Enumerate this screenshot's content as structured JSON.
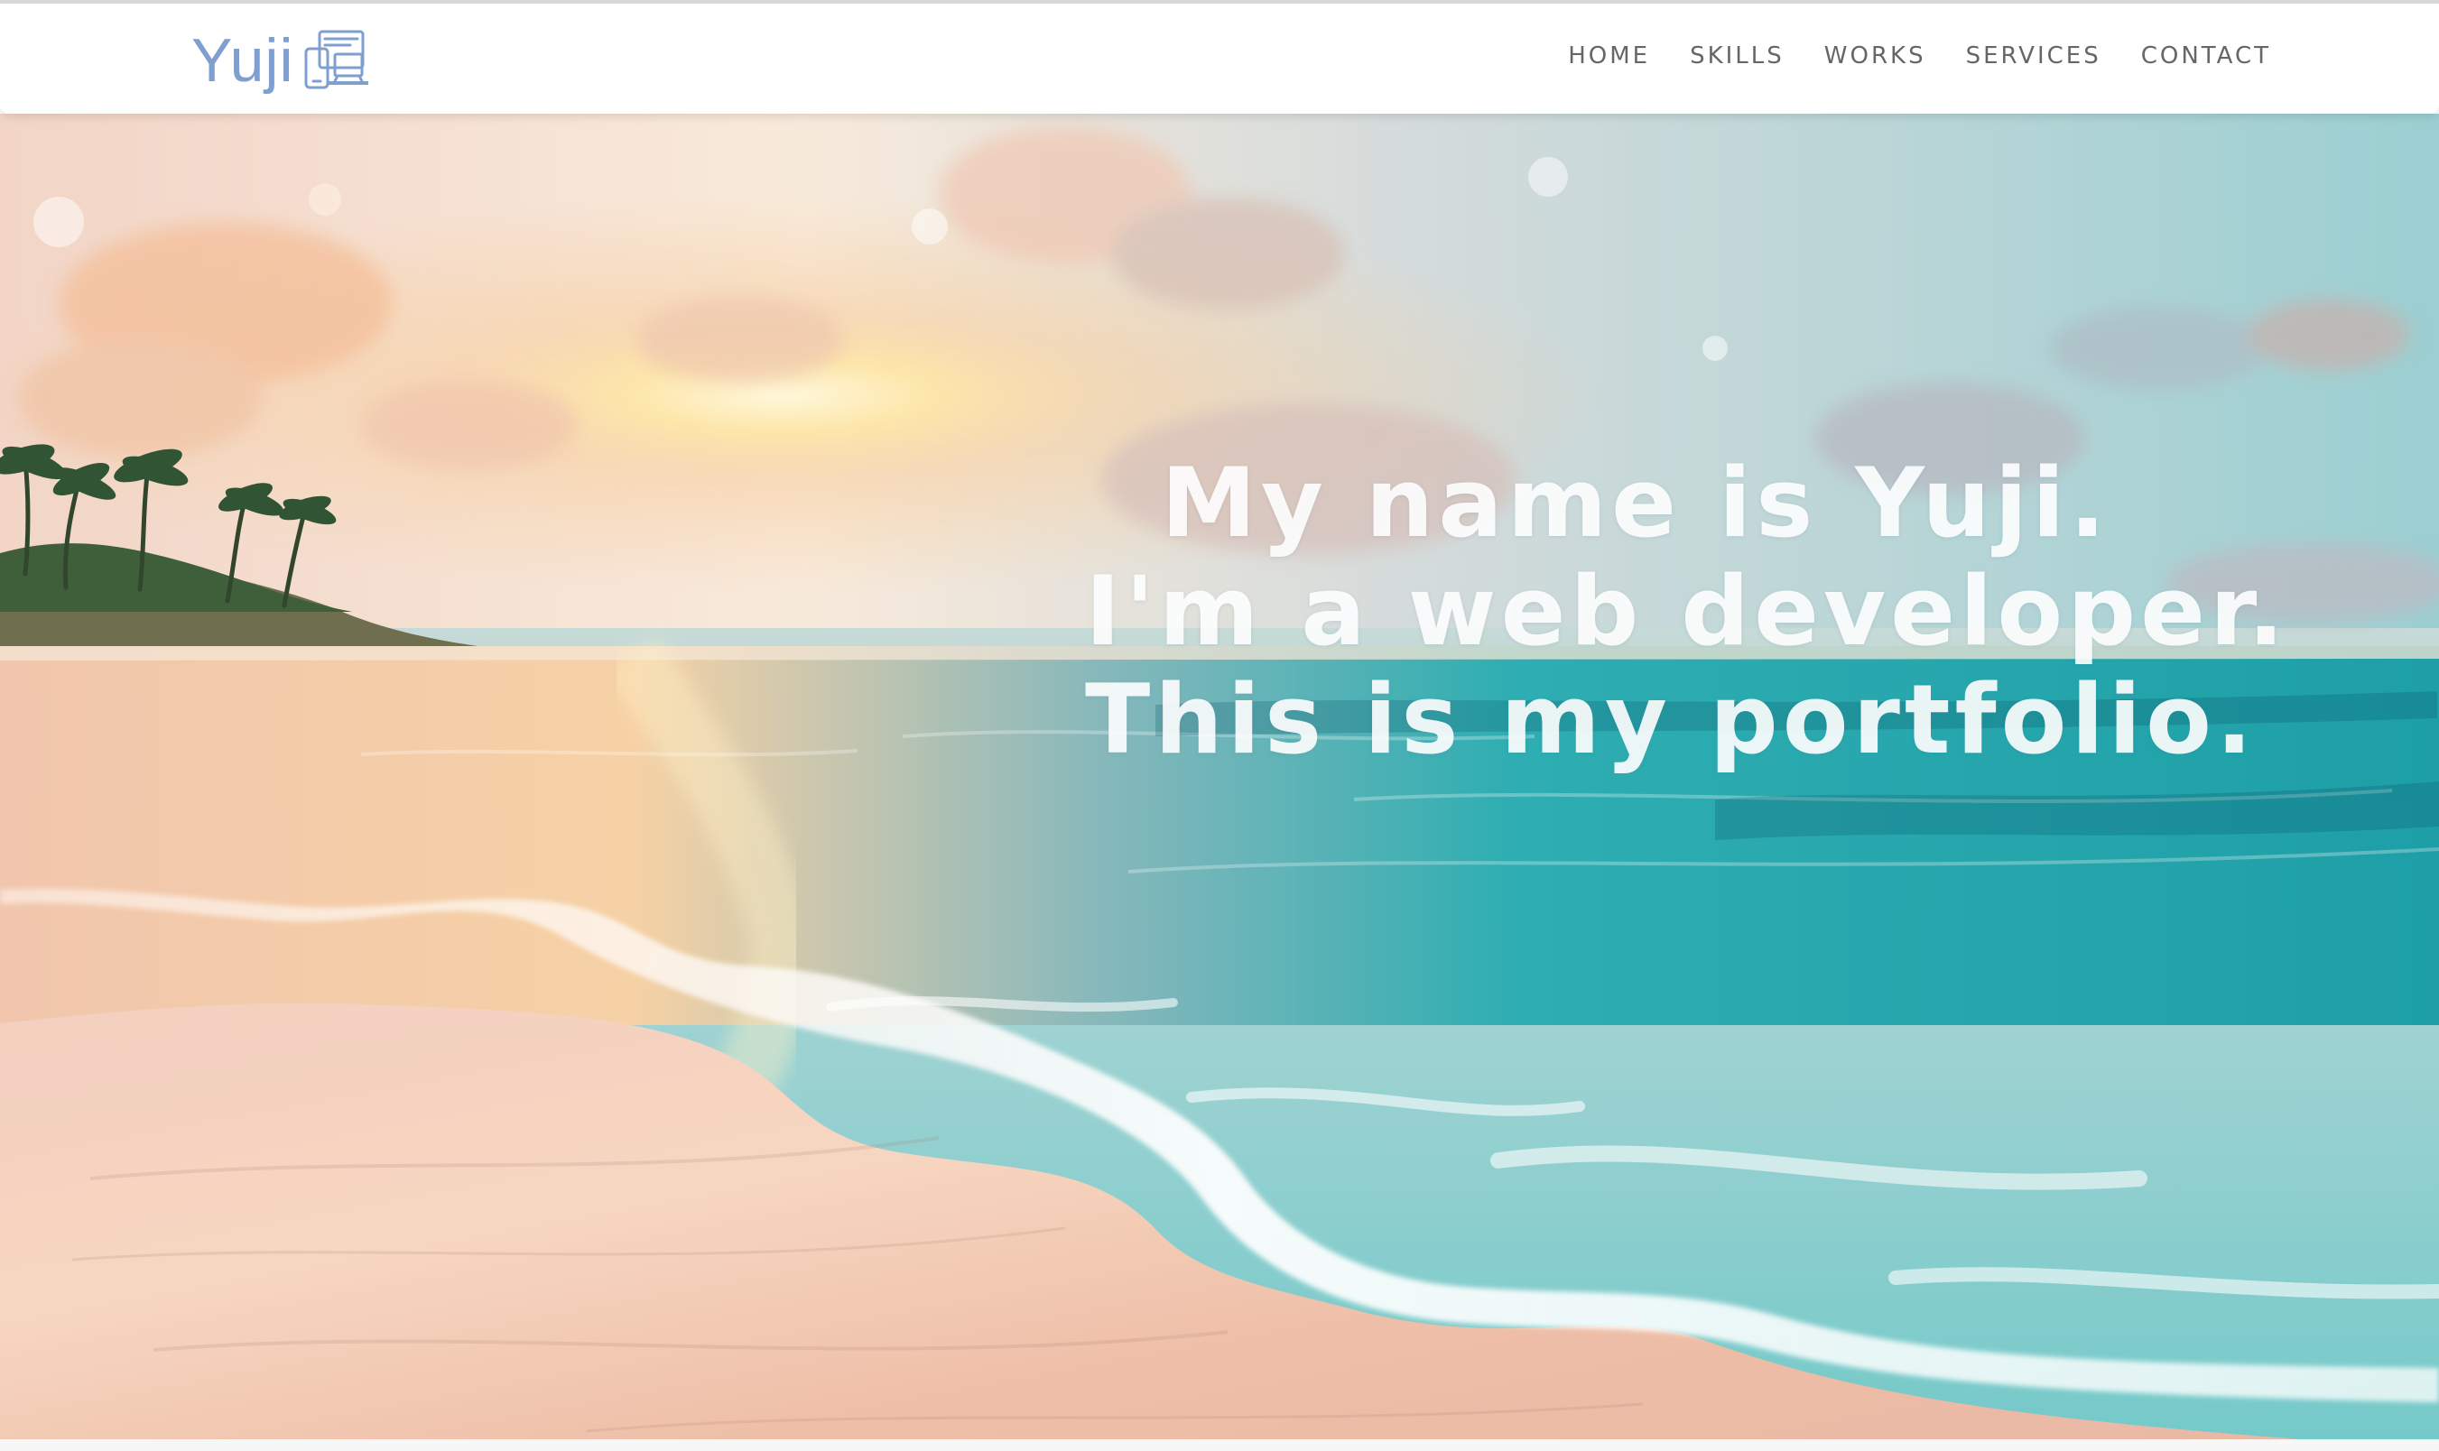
{
  "header": {
    "logo_text": "Yuji",
    "logo_icon": "device-logo-icon"
  },
  "nav": {
    "items": [
      {
        "label": "HOME"
      },
      {
        "label": "SKILLS"
      },
      {
        "label": "WORKS"
      },
      {
        "label": "SERVICES"
      },
      {
        "label": "CONTACT"
      }
    ]
  },
  "hero": {
    "lines": [
      "My name is Yuji.",
      "I'm a web developer.",
      "This is my portfolio."
    ],
    "background": "beach-sunset-hero-image"
  },
  "colors": {
    "logo": "#7f9fd0",
    "nav_text": "#666666",
    "hero_text": "#ffffff",
    "sea": "#36b2b5",
    "sand": "#f2c8b6",
    "sky": "#d7d9d8"
  }
}
